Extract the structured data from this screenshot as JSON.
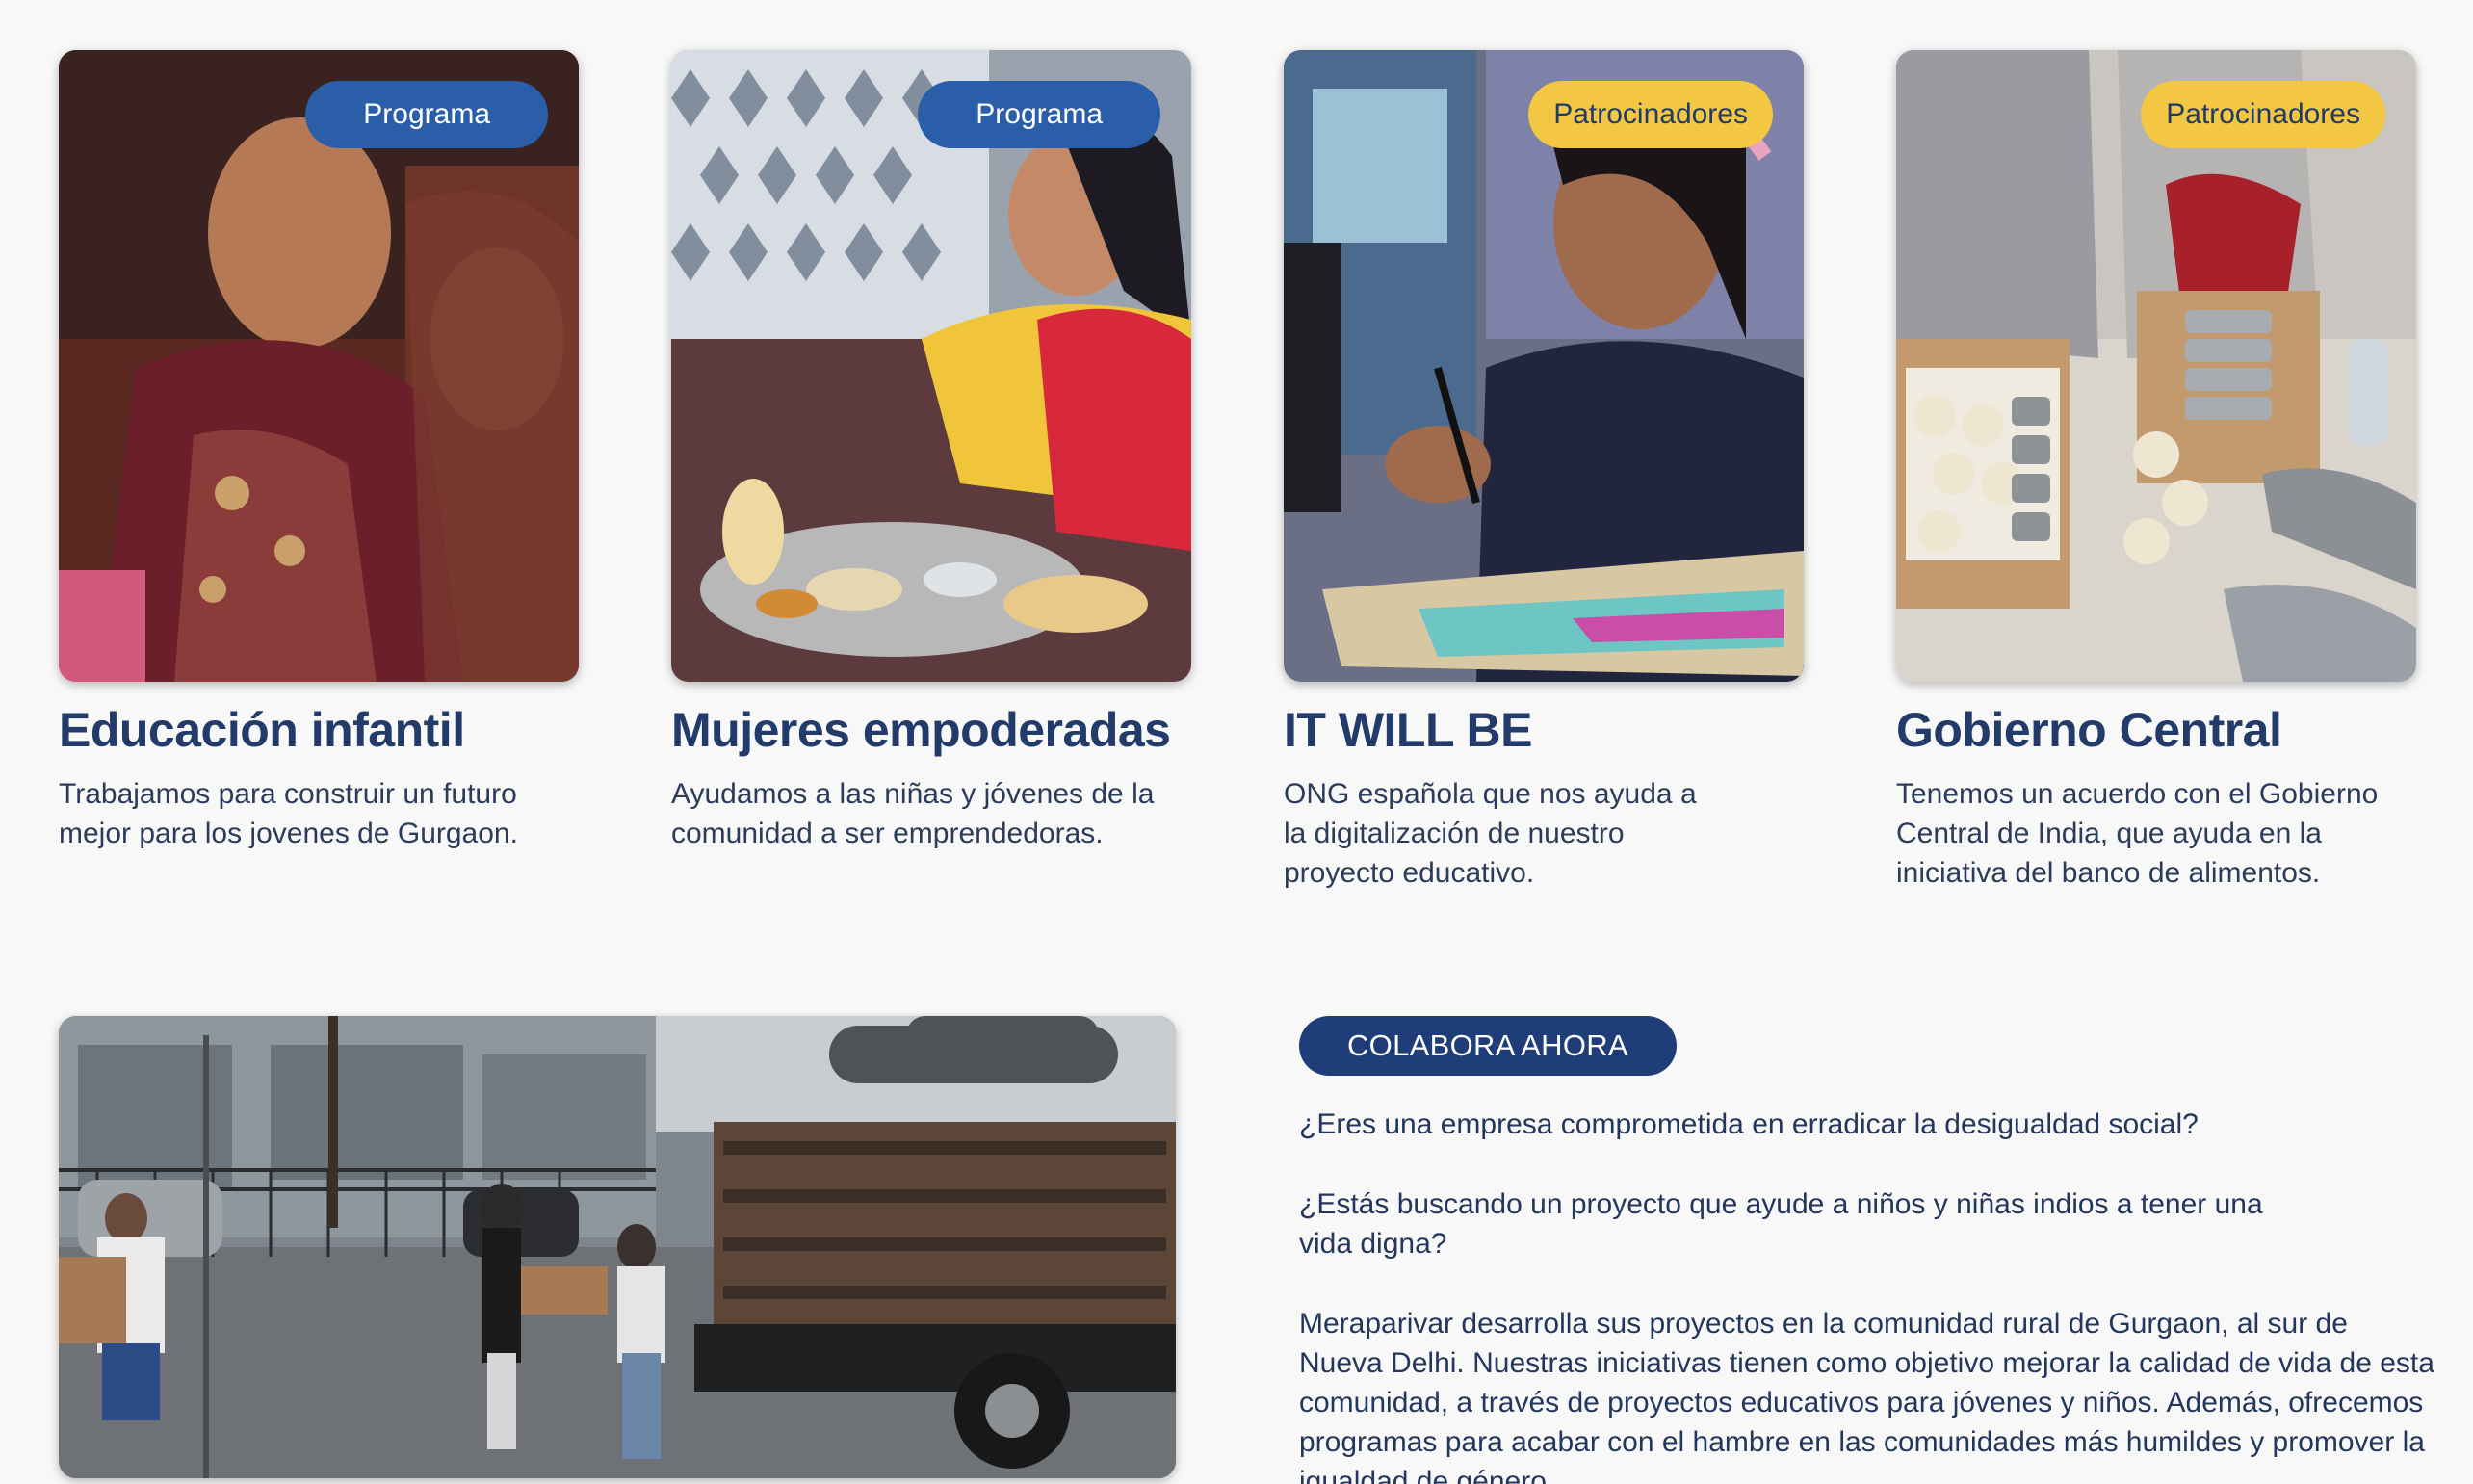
{
  "cards": [
    {
      "badge": "Programa",
      "title": "Educación infantil",
      "description": "Trabajamos para construir un futuro mejor para los jovenes de Gurgaon."
    },
    {
      "badge": "Programa",
      "title": "Mujeres empoderadas",
      "description": "Ayudamos a las niñas y jóvenes de la comunidad a ser emprendedoras."
    },
    {
      "badge": "Patrocinadores",
      "title": "IT WILL BE",
      "description": "ONG española que nos ayuda a la digitalización de nuestro proyecto educativo."
    },
    {
      "badge": "Patrocinadores",
      "title": "Gobierno Central",
      "description": "Tenemos un acuerdo con el Gobierno Central de India, que ayuda en la iniciativa del banco de alimentos."
    }
  ],
  "collaborate": {
    "button_label": "COLABORA AHORA",
    "paragraph_1": "¿Eres una empresa comprometida en erradicar la desigualdad social?",
    "paragraph_2": "¿Estás buscando un proyecto que ayude a niños y niñas indios a tener una vida digna?",
    "paragraph_3": "Meraparivar desarrolla sus proyectos en la comunidad rural de Gurgaon, al sur de Nueva Delhi. Nuestras iniciativas tienen como objetivo mejorar la calidad de vida de esta comunidad, a través de proyectos educativos para jóvenes y niños. Además, ofrecemos programas para acabar con el hambre en las comunidades más humildes y promover la igualdad de género."
  },
  "colors": {
    "badge_programa": "#2a5ea8",
    "badge_patrocinadores": "#f4c742",
    "title_text": "#223b6b",
    "button_bg": "#1f3d78",
    "page_bg": "#f8f8f8"
  }
}
